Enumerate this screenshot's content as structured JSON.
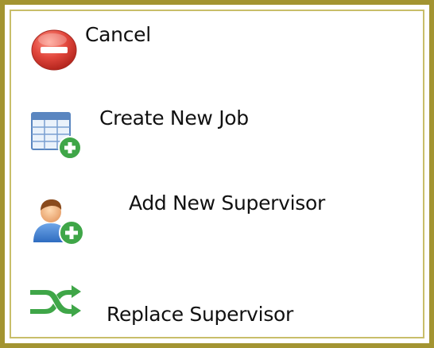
{
  "menu": {
    "items": [
      {
        "label": "Cancel",
        "icon": "cancel-icon"
      },
      {
        "label": "Create New Job",
        "icon": "create-job-icon"
      },
      {
        "label": "Add New Supervisor",
        "icon": "add-user-icon"
      },
      {
        "label": "Replace Supervisor",
        "icon": "replace-icon"
      }
    ]
  },
  "colors": {
    "border": "#a39431",
    "cancel_red": "#e2473d",
    "add_green": "#3fa648",
    "text": "#111111"
  }
}
